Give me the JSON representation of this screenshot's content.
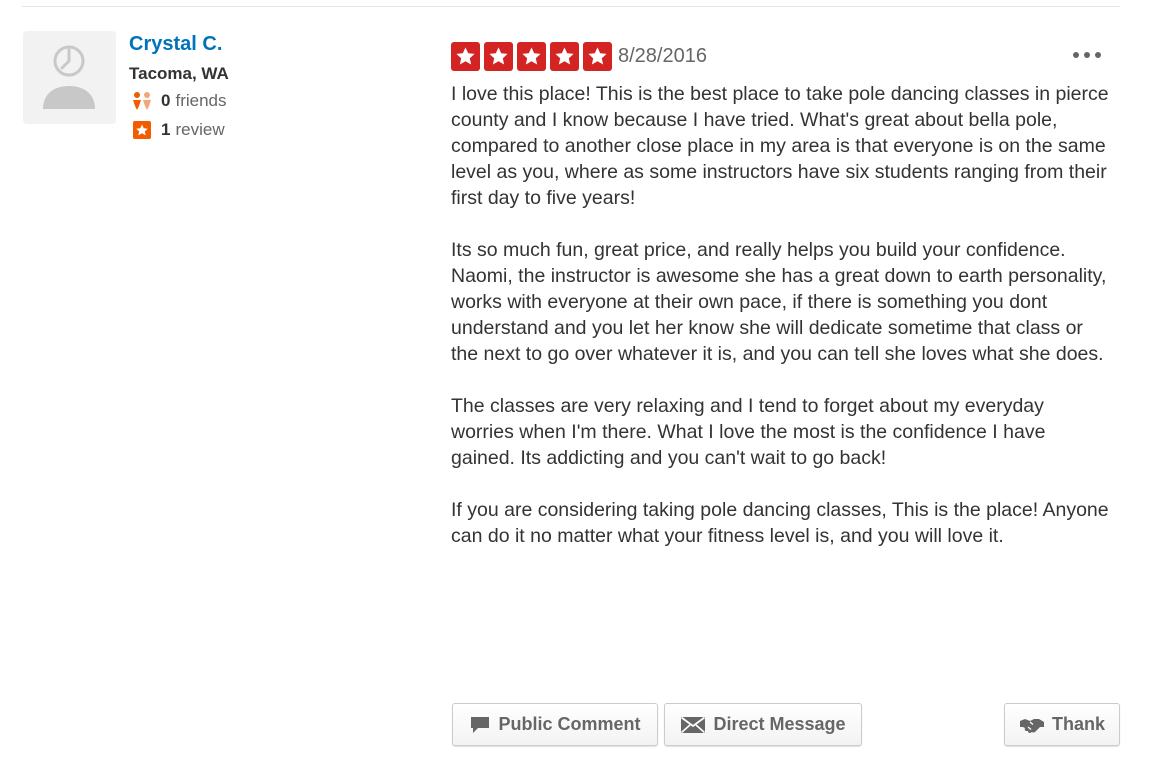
{
  "reviewer": {
    "name": "Crystal C.",
    "location": "Tacoma, WA",
    "friends_count": "0",
    "friends_label": "friends",
    "reviews_count": "1",
    "reviews_label": "review",
    "avatar_icon": "default-user-avatar-icon",
    "friends_icon": "friends-icon",
    "review_icon": "review-star-icon"
  },
  "review": {
    "rating": 5,
    "max_rating": 5,
    "date": "8/28/2016",
    "more_icon": "more-options-icon",
    "paragraphs": [
      "I love this place! This is the best place to take pole dancing classes in pierce county and I know because I have tried. What's great about bella pole, compared to another close place in my area is that everyone is on the same level as you, where as some instructors have six students ranging from their first day to five years!",
      "Its so much fun, great price, and really helps you build your confidence. Naomi, the instructor is awesome she has a great down to earth personality, works with everyone at their own pace, if there is something you dont understand and you let her know she will dedicate sometime that class or the next to go over whatever it is, and you can tell she loves what she does.",
      "The classes are very relaxing and I tend to forget about my everyday worries when I'm there. What I love the most is the confidence I have gained. Its addicting and you can't wait to go back!",
      "If you are considering taking pole dancing classes, This is the place! Anyone can do it no matter what your fitness level is, and you will love it."
    ]
  },
  "actions": {
    "public_comment": "Public Comment",
    "direct_message": "Direct Message",
    "thank": "Thank"
  },
  "colors": {
    "star_red": "#d32323",
    "link_blue": "#0073bb",
    "friends_orange": "#f15c00",
    "review_badge_orange": "#f15c00"
  }
}
